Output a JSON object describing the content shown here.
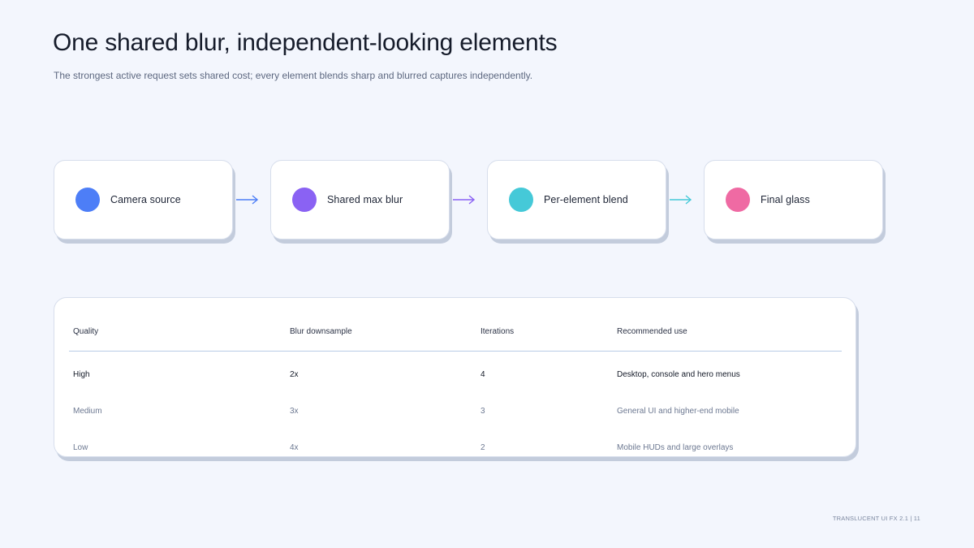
{
  "title": "One shared blur, independent-looking elements",
  "subtitle": "The strongest active request sets shared cost; every element blends sharp and blurred captures independently.",
  "pipeline": [
    {
      "label": "Camera source",
      "color": "#4d7ef7"
    },
    {
      "label": "Shared max blur",
      "color": "#8a62f3"
    },
    {
      "label": "Per-element blend",
      "color": "#45c9d8"
    },
    {
      "label": "Final glass",
      "color": "#ef6aa3"
    }
  ],
  "arrow_colors": [
    "#4d7ef7",
    "#8a62f3",
    "#45c9d8"
  ],
  "table": {
    "headers": [
      "Quality",
      "Blur downsample",
      "Iterations",
      "Recommended use"
    ],
    "rows": [
      [
        "High",
        "2x",
        "4",
        "Desktop, console and hero menus"
      ],
      [
        "Medium",
        "3x",
        "3",
        "General UI and higher-end mobile"
      ],
      [
        "Low",
        "4x",
        "2",
        "Mobile HUDs and large overlays"
      ]
    ]
  },
  "footer": "TRANSLUCENT UI FX 2.1  |  11"
}
